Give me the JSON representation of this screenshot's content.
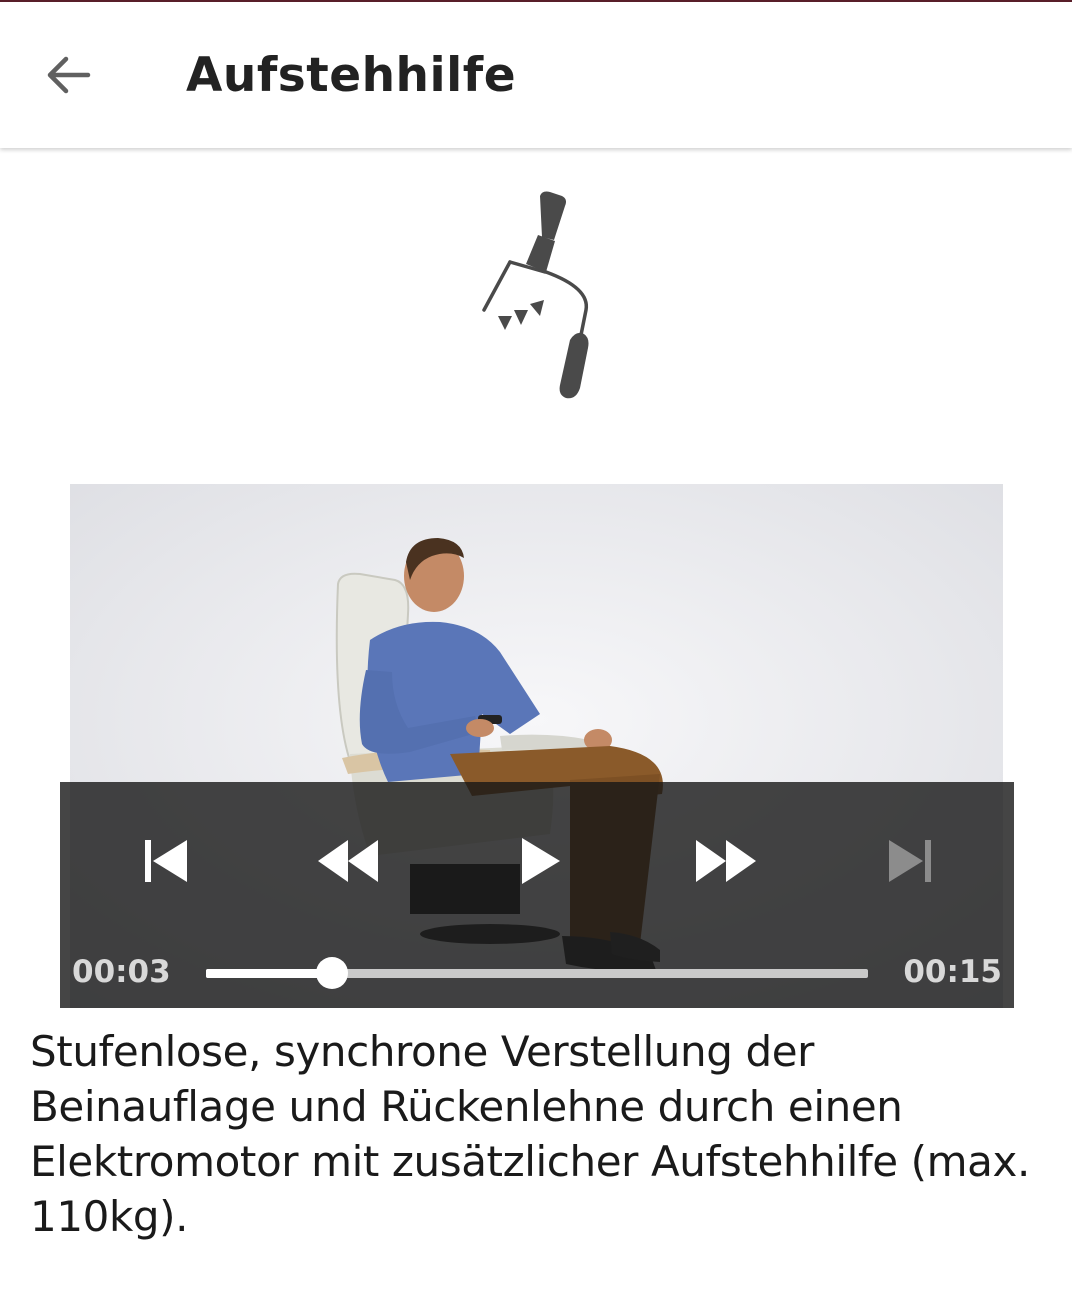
{
  "header": {
    "back_icon": "arrow-left-icon",
    "title": "Aufstehhilfe"
  },
  "feature_icon": "stand-up-assist-chair-icon",
  "video": {
    "current_time": "00:03",
    "total_time": "00:15",
    "progress": 0.19,
    "controls": {
      "skip_previous": "skip-previous-icon",
      "rewind": "rewind-icon",
      "play": "play-icon",
      "fast_forward": "fast-forward-icon",
      "skip_next": "skip-next-icon"
    }
  },
  "description": "Stufenlose, synchrone Verstellung der Beinauflage und Rückenlehne durch einen Elektromotor mit zusätzlicher Aufstehhilfe (max. 110kg).",
  "colors": {
    "status_bar_accent": "#5a1f2a",
    "title_text": "#222222",
    "icon_gray": "#555555",
    "controls_overlay": "#161616"
  }
}
